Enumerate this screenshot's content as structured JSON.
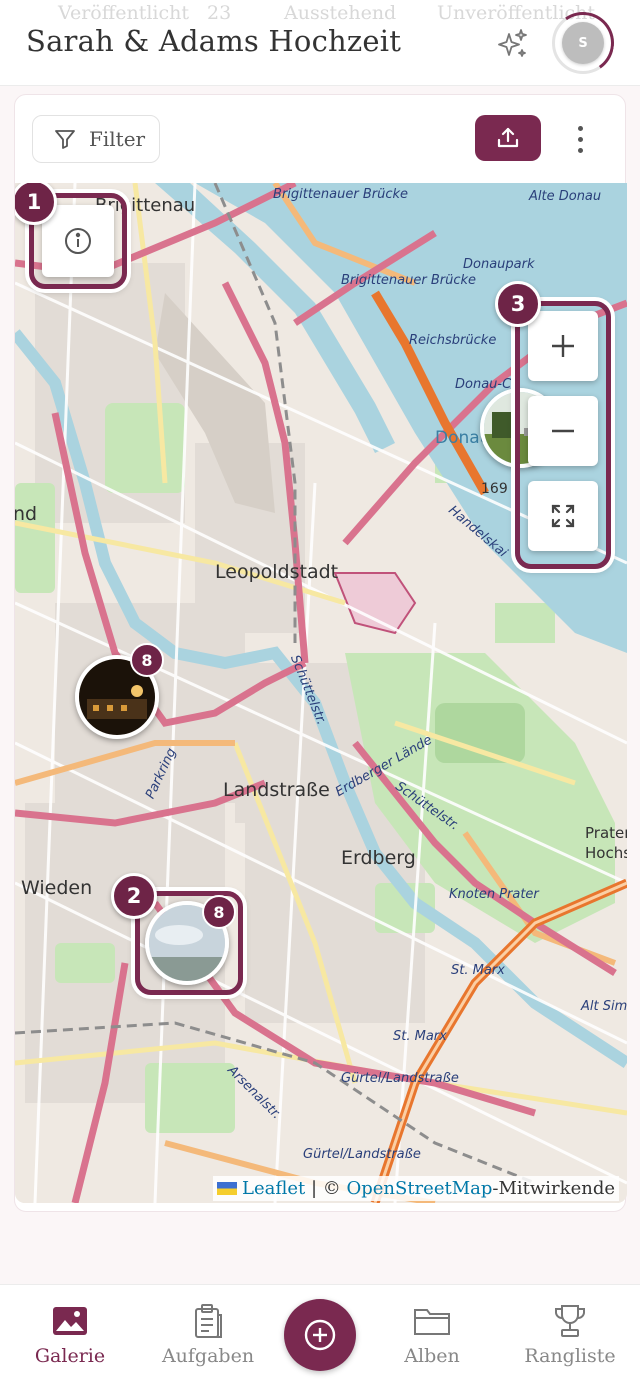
{
  "header": {
    "title": "Sarah & Adams Hochzeit",
    "ghost_tabs": [
      "Veröffentlicht",
      "23",
      "Ausstehend",
      "Unveröffentlicht"
    ],
    "avatar_initial": "S",
    "icons": {
      "sparkle": "sparkle-icon",
      "avatar": "avatar"
    }
  },
  "toolbar": {
    "filter_label": "Filter",
    "icons": {
      "filter": "funnel-icon",
      "upload": "upload-icon",
      "more": "more-vertical-icon"
    }
  },
  "map": {
    "labels": {
      "district_1": "Brigittenau",
      "district_2": "Leopoldstadt",
      "district_3": "Landstraße",
      "district_4": "Erdberg",
      "district_5": "Wieden",
      "district_6": "Prater Hochstraße",
      "district_7": "Donaustadt",
      "left_edge": "nd",
      "number_169": "169"
    },
    "streets": [
      "Brigittenauer Brücke",
      "Brigittenauer Brücke",
      "Alte Donau",
      "Donaupark",
      "Reichsbrücke",
      "Donau-City",
      "Handelskai",
      "Schüttelstr.",
      "Erdberger Lände",
      "Schüttelstr.",
      "Parkring",
      "Knoten Prater",
      "St. Marx",
      "St. Marx",
      "Gürtel/Landstraße",
      "Gürtel/Landstraße",
      "Alt Sim",
      "Arsenalstr."
    ],
    "controls": {
      "info": "info-icon",
      "zoom_in": "plus-icon",
      "zoom_out": "minus-icon",
      "fullscreen": "fullscreen-icon"
    },
    "markers": [
      {
        "count": "8",
        "image": "night-scene"
      },
      {
        "count": "8",
        "image": "sky-scene"
      },
      {
        "count": "",
        "image": "park-scene"
      }
    ],
    "step_badges": [
      "1",
      "2",
      "3"
    ],
    "attribution": {
      "leaflet": "Leaflet",
      "separator": " | © ",
      "osm": "OpenStreetMap",
      "suffix": "-Mitwirkende"
    }
  },
  "bottom_nav": {
    "items": [
      {
        "label": "Galerie",
        "icon": "image-icon",
        "active": true
      },
      {
        "label": "Aufgaben",
        "icon": "clipboard-icon",
        "active": false
      },
      {
        "label": "Alben",
        "icon": "folder-icon",
        "active": false
      },
      {
        "label": "Rangliste",
        "icon": "trophy-icon",
        "active": false
      }
    ],
    "fab_icon": "plus-circle-icon"
  },
  "colors": {
    "accent": "#7a2950",
    "badge": "#6e2447",
    "link": "#0078a8"
  }
}
